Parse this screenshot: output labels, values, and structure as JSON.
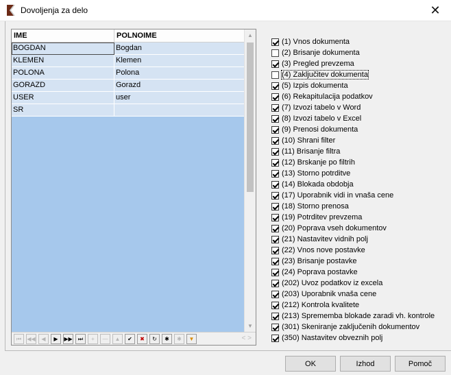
{
  "window": {
    "title": "Dovoljenja za delo",
    "close_glyph": "✕"
  },
  "grid": {
    "columns": [
      "IME",
      "POLNOIME"
    ],
    "rows": [
      [
        "BOGDAN",
        "Bogdan"
      ],
      [
        "KLEMEN",
        "Klemen"
      ],
      [
        "POLONA",
        "Polona"
      ],
      [
        "GORAZD",
        "Gorazd"
      ],
      [
        "USER",
        "user"
      ],
      [
        "SR",
        ""
      ]
    ],
    "selected_row": 0
  },
  "navigator": {
    "buttons": [
      {
        "name": "first-record-icon",
        "glyph": "⏮"
      },
      {
        "name": "prior-page-icon",
        "glyph": "◀◀"
      },
      {
        "name": "prior-record-icon",
        "glyph": "◀"
      },
      {
        "name": "next-record-icon",
        "glyph": "▶"
      },
      {
        "name": "next-page-icon",
        "glyph": "▶▶"
      },
      {
        "name": "last-record-icon",
        "glyph": "⏭"
      },
      {
        "name": "insert-icon",
        "glyph": "+"
      },
      {
        "name": "delete-icon",
        "glyph": "—"
      },
      {
        "name": "edit-icon",
        "glyph": "▲"
      },
      {
        "name": "post-icon",
        "glyph": "✔"
      },
      {
        "name": "cancel-icon",
        "glyph": "✖"
      },
      {
        "name": "refresh-icon",
        "glyph": "↻"
      },
      {
        "name": "bookmark-icon",
        "glyph": "✱"
      },
      {
        "name": "goto-bookmark-icon",
        "glyph": "✱"
      },
      {
        "name": "filter-icon",
        "glyph": "▼"
      }
    ],
    "scroll_arrows": "< >"
  },
  "permissions": [
    {
      "label": "(1) Vnos dokumenta",
      "checked": true
    },
    {
      "label": "(2) Brisanje dokumenta",
      "checked": false
    },
    {
      "label": "(3) Pregled prevzema",
      "checked": true
    },
    {
      "label": "(4) Zaključitev dokumenta",
      "checked": false,
      "focused": true
    },
    {
      "label": "(5) Izpis dokumenta",
      "checked": true
    },
    {
      "label": "(6) Rekapitulacija podatkov",
      "checked": true
    },
    {
      "label": "(7) Izvozi tabelo v Word",
      "checked": true
    },
    {
      "label": "(8) Izvozi tabelo v Excel",
      "checked": true
    },
    {
      "label": "(9) Prenosi dokumenta",
      "checked": true
    },
    {
      "label": "(10) Shrani filter",
      "checked": true
    },
    {
      "label": "(11) Brisanje filtra",
      "checked": true
    },
    {
      "label": "(12) Brskanje po filtrih",
      "checked": true
    },
    {
      "label": "(13) Storno potrditve",
      "checked": true
    },
    {
      "label": "(14) Blokada obdobja",
      "checked": true
    },
    {
      "label": "(17) Uporabnik vidi in vnaša cene",
      "checked": true
    },
    {
      "label": "(18) Storno prenosa",
      "checked": true
    },
    {
      "label": "(19) Potrditev prevzema",
      "checked": true
    },
    {
      "label": "(20) Poprava vseh dokumentov",
      "checked": true
    },
    {
      "label": "(21) Nastavitev vidnih polj",
      "checked": true
    },
    {
      "label": "(22) Vnos nove postavke",
      "checked": true
    },
    {
      "label": "(23) Brisanje postavke",
      "checked": true
    },
    {
      "label": "(24) Poprava postavke",
      "checked": true
    },
    {
      "label": "(202) Uvoz podatkov iz excela",
      "checked": true
    },
    {
      "label": "(203) Uporabnik vnaša cene",
      "checked": true
    },
    {
      "label": "(212) Kontrola kvalitete",
      "checked": true
    },
    {
      "label": "(213) Sprememba blokade zaradi vh. kontrole",
      "checked": true
    },
    {
      "label": "(301) Skeniranje zaključenih dokumentov",
      "checked": true
    },
    {
      "label": "(350) Nastavitev obveznih polj",
      "checked": true
    }
  ],
  "buttons": {
    "ok": "OK",
    "exit": "Izhod",
    "help": "Pomoč"
  }
}
